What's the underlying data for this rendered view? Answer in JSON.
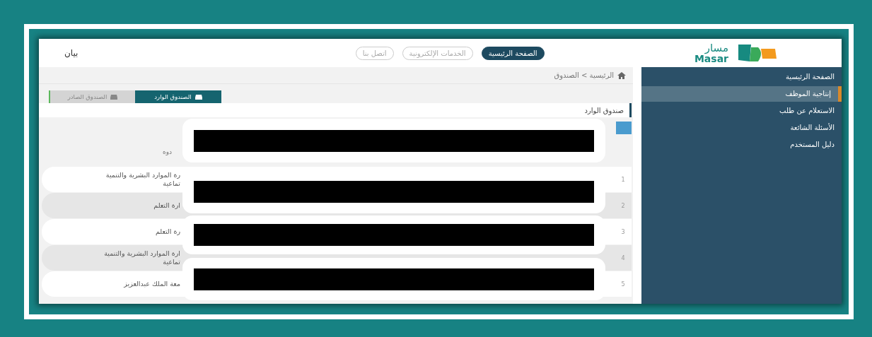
{
  "header": {
    "user": "بيان",
    "nav": [
      {
        "label": "الصفحة الرئيسية",
        "selected": true
      },
      {
        "label": "الخدمات الإلكترونية",
        "selected": false
      },
      {
        "label": "اتصل بنا",
        "selected": false
      }
    ],
    "logo": {
      "arabic": "مسار",
      "latin": "Masar"
    }
  },
  "breadcrumb": "الرئيسية > الصندوق",
  "tabs": [
    {
      "label": "الصندوق الوارد",
      "selected": true
    },
    {
      "label": "الصندوق الصادر",
      "selected": false
    }
  ],
  "section_title": "صندوق الوارد",
  "filter_label": "دوه",
  "rows": [
    {
      "number": "1",
      "lines": [
        "رة الموارد البشرية والتنمية",
        "تماعية"
      ]
    },
    {
      "number": "2",
      "lines": [
        "ارة التعلم"
      ]
    },
    {
      "number": "3",
      "lines": [
        "رة التعلم"
      ]
    },
    {
      "number": "4",
      "lines": [
        "ارة الموارد البشرية والتنمية",
        "تماعية"
      ]
    },
    {
      "number": "5",
      "lines": [
        "معة الملك عبدالعزيز"
      ]
    }
  ],
  "sidebar": {
    "items": [
      {
        "label": "الصفحة الرئيسية",
        "selected": false
      },
      {
        "label": "إنتاجية الموظف",
        "selected": true
      },
      {
        "label": "الاستعلام عن طلب",
        "selected": false
      },
      {
        "label": "الأسئلة الشائعة",
        "selected": false
      },
      {
        "label": "دليل المستخدم",
        "selected": false
      }
    ]
  },
  "redactions": [
    {
      "kind": "bar"
    },
    {
      "kind": "bar"
    },
    {
      "kind": "bar"
    },
    {
      "kind": "bar"
    }
  ]
}
